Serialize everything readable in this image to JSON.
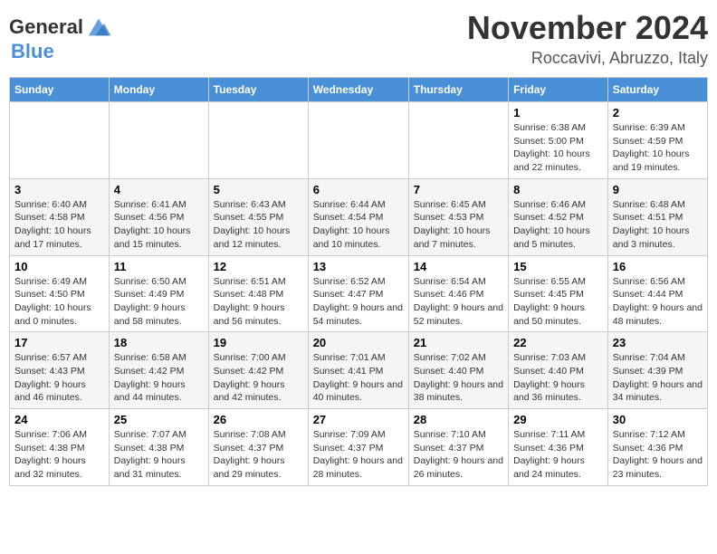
{
  "logo": {
    "line1": "General",
    "line2": "Blue"
  },
  "title": "November 2024",
  "location": "Roccavivi, Abruzzo, Italy",
  "headers": [
    "Sunday",
    "Monday",
    "Tuesday",
    "Wednesday",
    "Thursday",
    "Friday",
    "Saturday"
  ],
  "weeks": [
    [
      {
        "day": "",
        "info": ""
      },
      {
        "day": "",
        "info": ""
      },
      {
        "day": "",
        "info": ""
      },
      {
        "day": "",
        "info": ""
      },
      {
        "day": "",
        "info": ""
      },
      {
        "day": "1",
        "info": "Sunrise: 6:38 AM\nSunset: 5:00 PM\nDaylight: 10 hours and 22 minutes."
      },
      {
        "day": "2",
        "info": "Sunrise: 6:39 AM\nSunset: 4:59 PM\nDaylight: 10 hours and 19 minutes."
      }
    ],
    [
      {
        "day": "3",
        "info": "Sunrise: 6:40 AM\nSunset: 4:58 PM\nDaylight: 10 hours and 17 minutes."
      },
      {
        "day": "4",
        "info": "Sunrise: 6:41 AM\nSunset: 4:56 PM\nDaylight: 10 hours and 15 minutes."
      },
      {
        "day": "5",
        "info": "Sunrise: 6:43 AM\nSunset: 4:55 PM\nDaylight: 10 hours and 12 minutes."
      },
      {
        "day": "6",
        "info": "Sunrise: 6:44 AM\nSunset: 4:54 PM\nDaylight: 10 hours and 10 minutes."
      },
      {
        "day": "7",
        "info": "Sunrise: 6:45 AM\nSunset: 4:53 PM\nDaylight: 10 hours and 7 minutes."
      },
      {
        "day": "8",
        "info": "Sunrise: 6:46 AM\nSunset: 4:52 PM\nDaylight: 10 hours and 5 minutes."
      },
      {
        "day": "9",
        "info": "Sunrise: 6:48 AM\nSunset: 4:51 PM\nDaylight: 10 hours and 3 minutes."
      }
    ],
    [
      {
        "day": "10",
        "info": "Sunrise: 6:49 AM\nSunset: 4:50 PM\nDaylight: 10 hours and 0 minutes."
      },
      {
        "day": "11",
        "info": "Sunrise: 6:50 AM\nSunset: 4:49 PM\nDaylight: 9 hours and 58 minutes."
      },
      {
        "day": "12",
        "info": "Sunrise: 6:51 AM\nSunset: 4:48 PM\nDaylight: 9 hours and 56 minutes."
      },
      {
        "day": "13",
        "info": "Sunrise: 6:52 AM\nSunset: 4:47 PM\nDaylight: 9 hours and 54 minutes."
      },
      {
        "day": "14",
        "info": "Sunrise: 6:54 AM\nSunset: 4:46 PM\nDaylight: 9 hours and 52 minutes."
      },
      {
        "day": "15",
        "info": "Sunrise: 6:55 AM\nSunset: 4:45 PM\nDaylight: 9 hours and 50 minutes."
      },
      {
        "day": "16",
        "info": "Sunrise: 6:56 AM\nSunset: 4:44 PM\nDaylight: 9 hours and 48 minutes."
      }
    ],
    [
      {
        "day": "17",
        "info": "Sunrise: 6:57 AM\nSunset: 4:43 PM\nDaylight: 9 hours and 46 minutes."
      },
      {
        "day": "18",
        "info": "Sunrise: 6:58 AM\nSunset: 4:42 PM\nDaylight: 9 hours and 44 minutes."
      },
      {
        "day": "19",
        "info": "Sunrise: 7:00 AM\nSunset: 4:42 PM\nDaylight: 9 hours and 42 minutes."
      },
      {
        "day": "20",
        "info": "Sunrise: 7:01 AM\nSunset: 4:41 PM\nDaylight: 9 hours and 40 minutes."
      },
      {
        "day": "21",
        "info": "Sunrise: 7:02 AM\nSunset: 4:40 PM\nDaylight: 9 hours and 38 minutes."
      },
      {
        "day": "22",
        "info": "Sunrise: 7:03 AM\nSunset: 4:40 PM\nDaylight: 9 hours and 36 minutes."
      },
      {
        "day": "23",
        "info": "Sunrise: 7:04 AM\nSunset: 4:39 PM\nDaylight: 9 hours and 34 minutes."
      }
    ],
    [
      {
        "day": "24",
        "info": "Sunrise: 7:06 AM\nSunset: 4:38 PM\nDaylight: 9 hours and 32 minutes."
      },
      {
        "day": "25",
        "info": "Sunrise: 7:07 AM\nSunset: 4:38 PM\nDaylight: 9 hours and 31 minutes."
      },
      {
        "day": "26",
        "info": "Sunrise: 7:08 AM\nSunset: 4:37 PM\nDaylight: 9 hours and 29 minutes."
      },
      {
        "day": "27",
        "info": "Sunrise: 7:09 AM\nSunset: 4:37 PM\nDaylight: 9 hours and 28 minutes."
      },
      {
        "day": "28",
        "info": "Sunrise: 7:10 AM\nSunset: 4:37 PM\nDaylight: 9 hours and 26 minutes."
      },
      {
        "day": "29",
        "info": "Sunrise: 7:11 AM\nSunset: 4:36 PM\nDaylight: 9 hours and 24 minutes."
      },
      {
        "day": "30",
        "info": "Sunrise: 7:12 AM\nSunset: 4:36 PM\nDaylight: 9 hours and 23 minutes."
      }
    ]
  ]
}
